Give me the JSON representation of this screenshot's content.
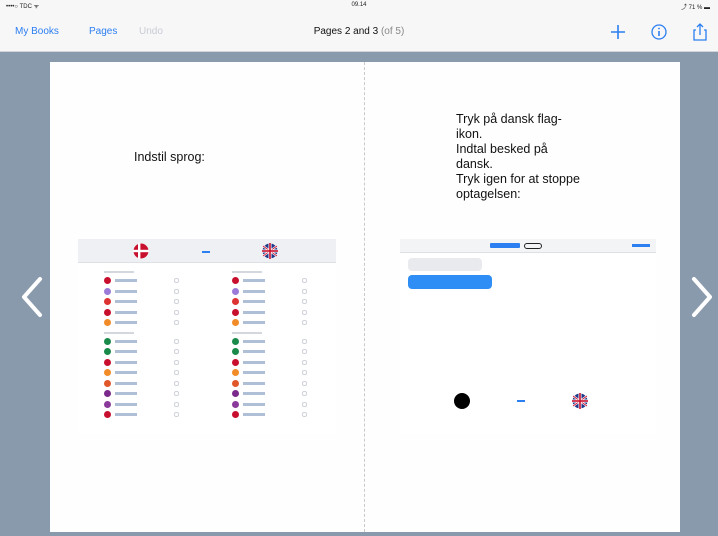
{
  "status_bar": {
    "carrier": "••••○ TDC ᯤ",
    "time": "09.14",
    "battery": "⤴ 71 % ▬"
  },
  "nav": {
    "my_books": "My Books",
    "pages": "Pages",
    "undo": "Undo",
    "title": "Pages 2 and 3",
    "title_sub": "(of 5)"
  },
  "icons": {
    "add": "plus-icon",
    "info": "info-icon",
    "share": "share-icon",
    "prev": "chevron-left-icon",
    "next": "chevron-right-icon"
  },
  "left_page": {
    "text": "Indstil sprog:"
  },
  "right_page": {
    "text": "Tryk på dansk flag-\nikon.\nIndtal besked på\ndansk.\nTryk igen for at stoppe\noptagelsen:"
  },
  "colors": {
    "accent": "#2c7ff0",
    "background": "#8a9aad"
  }
}
